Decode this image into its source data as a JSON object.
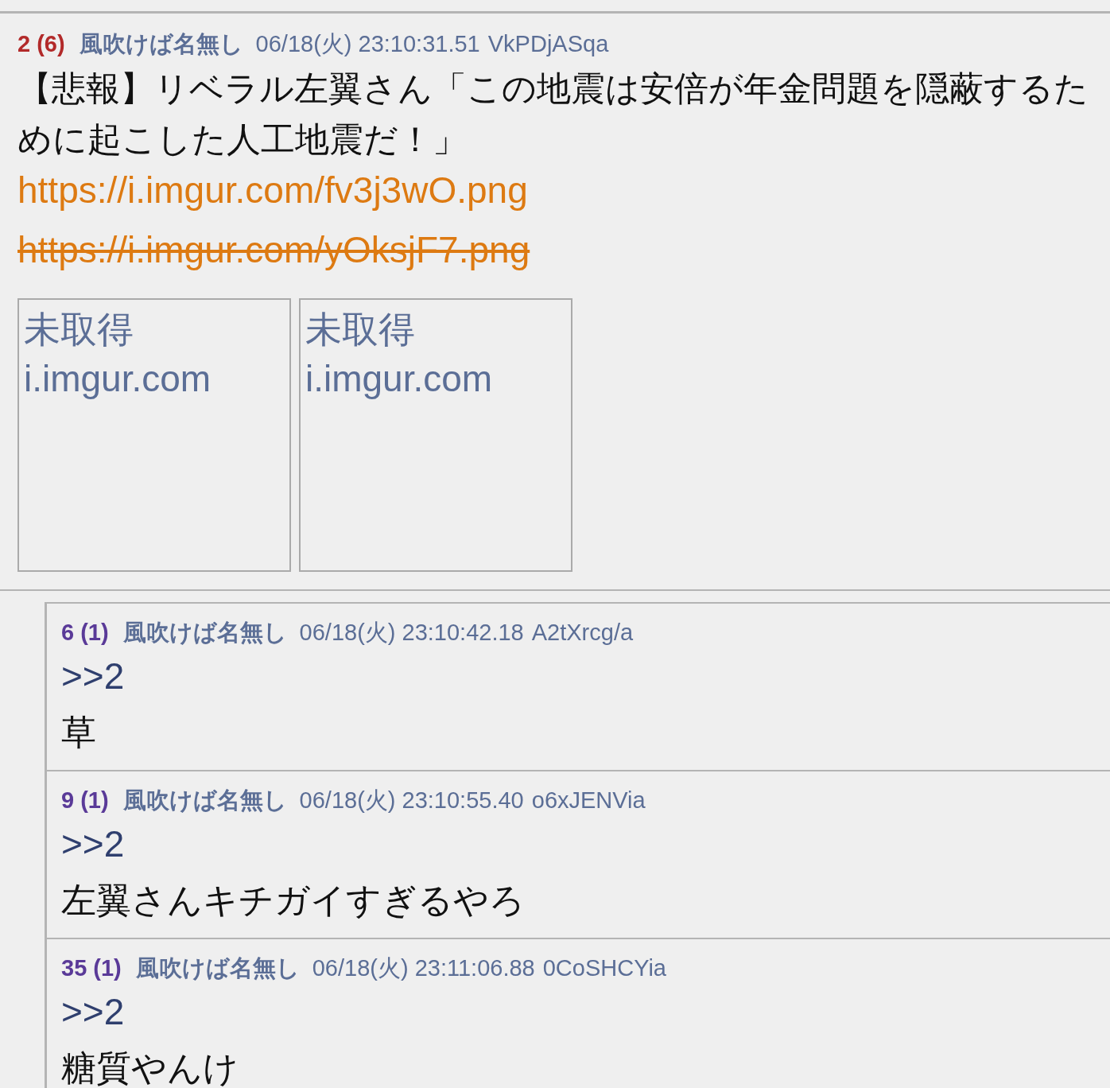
{
  "post": {
    "number": "2",
    "reply_count": "(6)",
    "color": "#b22a2a",
    "name": "風吹けば名無し",
    "date": "06/18(火) 23:10:31.51",
    "id": "VkPDjASqa",
    "body": [
      "【悲報】リベラル左翼さん「この地震は安倍が年金問題を隠蔽するために起こした人工地震だ！」"
    ],
    "links": [
      {
        "url": "https://i.imgur.com/fv3j3wO.png",
        "struck": false
      },
      {
        "url": "https://i.imgur.com/yOksjF7.png",
        "struck": true
      }
    ],
    "thumbnails": [
      {
        "status": "未取得",
        "domain": "i.imgur.com"
      },
      {
        "status": "未取得",
        "domain": "i.imgur.com"
      }
    ]
  },
  "replies": [
    {
      "number": "6",
      "reply_count": "(1)",
      "color": "#5a3a98",
      "name": "風吹けば名無し",
      "date": "06/18(火) 23:10:42.18",
      "id": "A2tXrcg/a",
      "anchor": ">>2",
      "body": "草"
    },
    {
      "number": "9",
      "reply_count": "(1)",
      "color": "#5a3a98",
      "name": "風吹けば名無し",
      "date": "06/18(火) 23:10:55.40",
      "id": "o6xJENVia",
      "anchor": ">>2",
      "body": "左翼さんキチガイすぎるやろ"
    },
    {
      "number": "35",
      "reply_count": "(1)",
      "color": "#5a3a98",
      "name": "風吹けば名無し",
      "date": "06/18(火) 23:11:06.88",
      "id": "0CoSHCYia",
      "anchor": ">>2",
      "body": "糖質やんけ"
    }
  ]
}
